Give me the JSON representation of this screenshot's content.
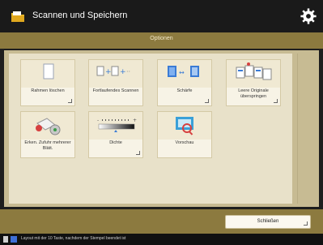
{
  "header": {
    "title": "Scannen und Speichern",
    "settings_icon": "gear-icon",
    "app_icon": "folder-icon"
  },
  "subheader": {
    "title": "Optionen"
  },
  "tiles": [
    {
      "label": "Rahmen löschen",
      "icon": "page-icon"
    },
    {
      "label": "Fortlaufendes Scannen",
      "icon": "continuous-scan-icon"
    },
    {
      "label": "Schärfe",
      "icon": "sharpness-icon"
    },
    {
      "label": "Leere Originale überspringen",
      "icon": "skip-blank-icon"
    },
    {
      "label": "Erken. Zufuhr mehrerer Blätt.",
      "icon": "multi-feed-icon"
    },
    {
      "label": "Dichte",
      "icon": "density-icon"
    },
    {
      "label": "Vorschau",
      "icon": "preview-icon"
    }
  ],
  "footer": {
    "close_label": "Schließen"
  },
  "statusbar": {
    "text": "Layout mit der 10 Taste, nachdem der Stempel beendet ist"
  },
  "colors": {
    "header_bg": "#1a1a1a",
    "accent": "#8c7a3f",
    "panel": "#c7bb93",
    "tile": "#f7f3e6"
  }
}
